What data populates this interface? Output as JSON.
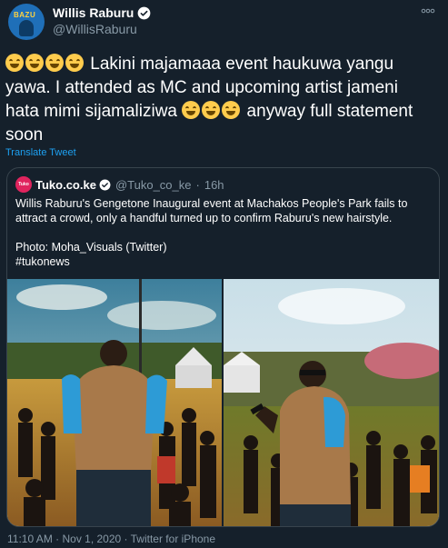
{
  "user": {
    "display_name": "Willis Raburu",
    "handle": "@WillisRaburu"
  },
  "tweet": {
    "line1_text": " Lakini majamaaa event haukuwa yangu",
    "line2_text": "yawa. I attended as MC and upcoming artist jameni",
    "line3_text": "hata mimi sijamaliziwa ",
    "line3_tail": " anyway full statement",
    "line4_text": "soon",
    "translate_label": "Translate Tweet",
    "emoji_icon": "rolling-on-floor-laughing"
  },
  "quote": {
    "avatar_text": "Tuko",
    "name": "Tuko.co.ke",
    "handle": "@Tuko_co_ke",
    "separator": "·",
    "time": "16h",
    "text": "Willis Raburu's Gengetone Inaugural event at Machakos People's Park fails to attract a crowd, only a handful turned up to confirm Raburu's new hairstyle.\n\nPhoto: Moha_Visuals (Twitter)\n#tukonews"
  },
  "footer": {
    "meta": "11:10 AM · Nov 1, 2020 · Twitter for iPhone"
  },
  "colors": {
    "background": "#15202b",
    "accent": "#1da1f2",
    "muted": "#8899a6",
    "border": "#38444d"
  }
}
